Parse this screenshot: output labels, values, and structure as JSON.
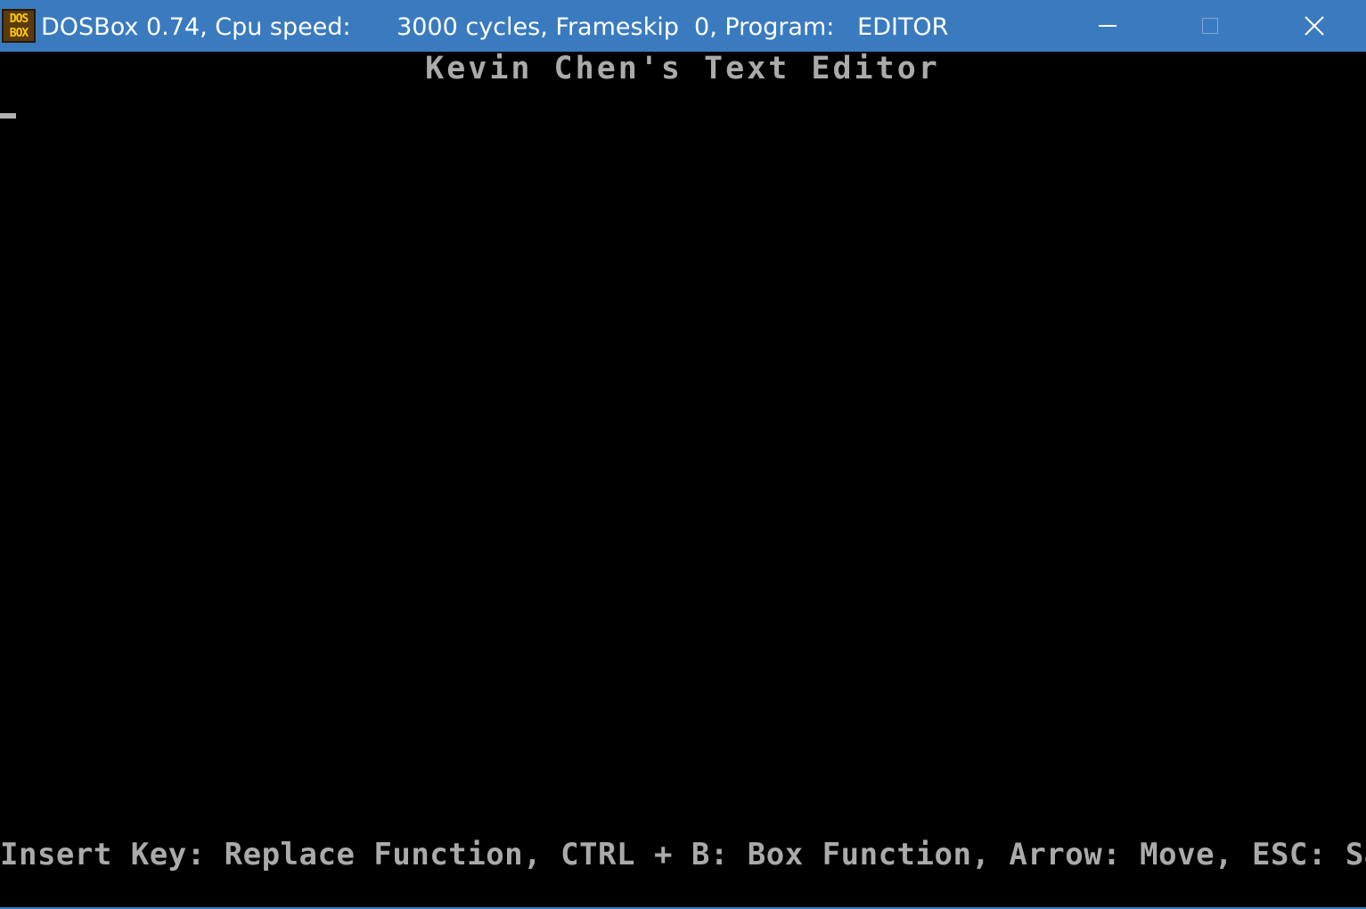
{
  "window": {
    "app_icon_line1": "DOS",
    "app_icon_line2": "BOX",
    "title": "DOSBox 0.74, Cpu speed:      3000 cycles, Frameskip  0, Program:   EDITOR",
    "controls": {
      "minimize_icon": "minimize-icon",
      "maximize_icon": "maximize-icon",
      "close_icon": "close-icon"
    },
    "colors": {
      "titlebar": "#3a7bbf",
      "screen_bg": "#000000",
      "screen_text": "#aaaaaa"
    }
  },
  "editor": {
    "title": "Kevin Chen's Text Editor",
    "status_line": "Insert Key: Replace Function, CTRL + B: Box Function, Arrow: Move, ESC: Saves"
  }
}
